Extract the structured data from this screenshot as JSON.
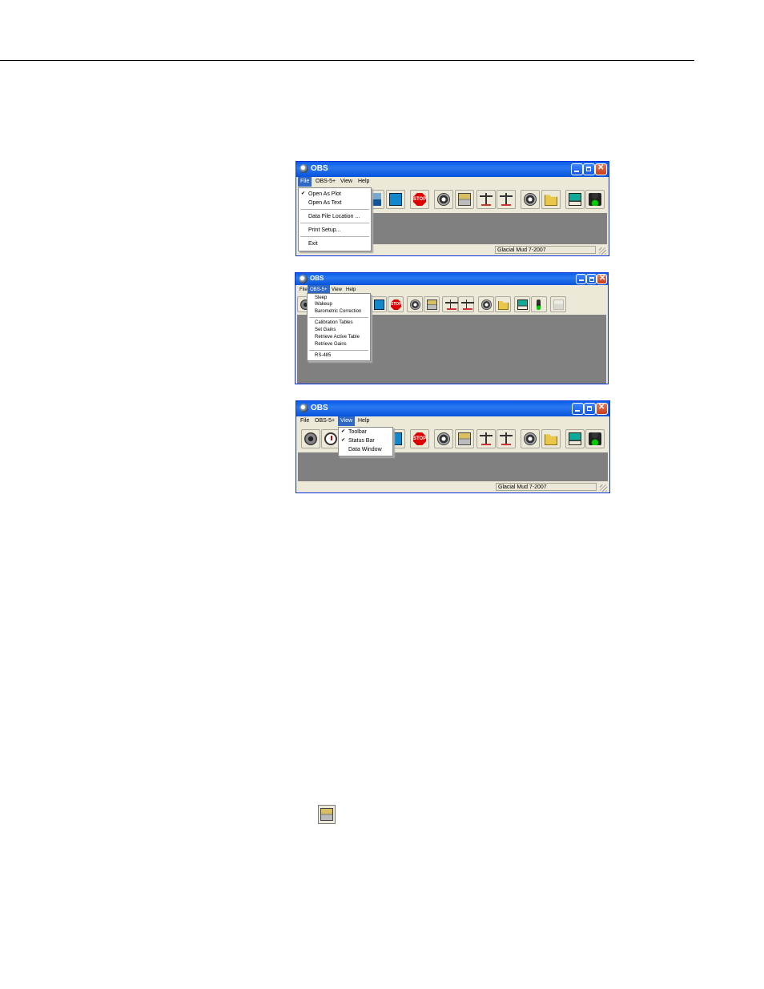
{
  "windows": [
    {
      "title": "OBS",
      "menu": [
        "File",
        "OBS-5+",
        "View",
        "Help"
      ],
      "active_menu": "File",
      "status_text": "Glacial Mud 7-2007",
      "dropdown": [
        {
          "label": "Open As Plot",
          "checked": true
        },
        {
          "label": "Open As Text",
          "checked": false
        },
        {
          "separator": true
        },
        {
          "label": "Data File Location ...",
          "checked": false
        },
        {
          "separator": true
        },
        {
          "label": "Print Setup...",
          "checked": false
        },
        {
          "separator": true
        },
        {
          "label": "Exit",
          "checked": false
        }
      ]
    },
    {
      "title": "OBS",
      "menu": [
        "File",
        "OBS-5+",
        "View",
        "Help"
      ],
      "active_menu": "OBS-5+",
      "status_text": "",
      "dropdown": [
        {
          "label": "Sleep"
        },
        {
          "label": "Wakeup"
        },
        {
          "label": "Barometric Correction"
        },
        {
          "separator": true
        },
        {
          "label": "Calibration Tables"
        },
        {
          "label": "Set Gains"
        },
        {
          "label": "Retrieve Active Table"
        },
        {
          "label": "Retrieve Gains"
        },
        {
          "separator": true
        },
        {
          "label": "RS-485"
        }
      ]
    },
    {
      "title": "OBS",
      "menu": [
        "File",
        "OBS-5+",
        "View",
        "Help"
      ],
      "active_menu": "View",
      "status_text": "Glacial Mud 7-2007",
      "dropdown": [
        {
          "label": "Toolbar",
          "checked": true
        },
        {
          "label": "Status Bar",
          "checked": true
        },
        {
          "label": "Data Window",
          "checked": false
        }
      ]
    }
  ],
  "toolbar_icons": [
    "gear-icon",
    "clock-icon",
    "seascape-icon",
    "document-icon",
    "stop-icon",
    "reel-arrow-icon",
    "modem-icon",
    "scale-icon",
    "scale-icon",
    "reel-icon",
    "open-folder-icon",
    "laptop-icon",
    "traffic-light-icon",
    "printer-icon"
  ],
  "colors": {
    "titlebar": "#0a5ee8",
    "menu_highlight": "#316ac5",
    "client_area": "#808080",
    "window_face": "#ece9d8",
    "close_button": "#c3401f"
  }
}
